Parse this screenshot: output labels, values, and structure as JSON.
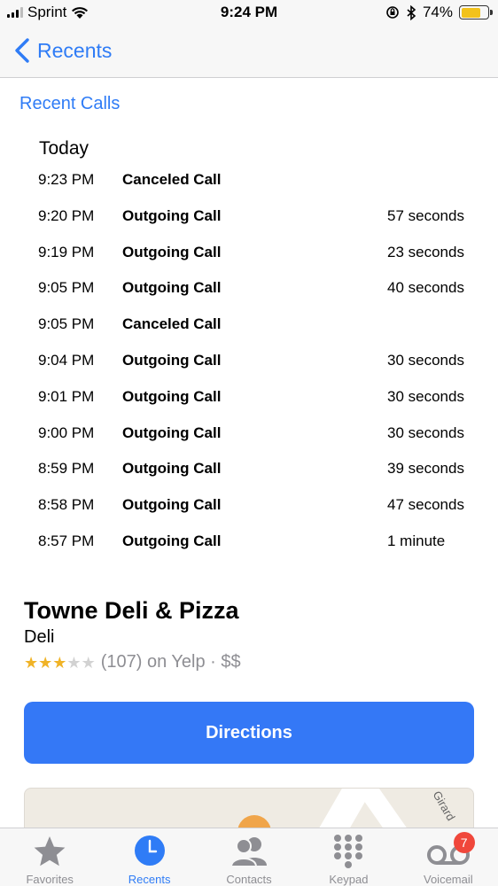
{
  "status_bar": {
    "carrier": "Sprint",
    "time": "9:24 PM",
    "battery": "74%",
    "battery_level": 0.74
  },
  "nav": {
    "back_label": "Recents"
  },
  "recent_calls": {
    "title": "Recent Calls",
    "day": "Today",
    "rows": [
      {
        "time": "9:23 PM",
        "type": "Canceled Call",
        "duration": ""
      },
      {
        "time": "9:20 PM",
        "type": "Outgoing Call",
        "duration": "57 seconds"
      },
      {
        "time": "9:19 PM",
        "type": "Outgoing Call",
        "duration": "23 seconds"
      },
      {
        "time": "9:05 PM",
        "type": "Outgoing Call",
        "duration": "40 seconds"
      },
      {
        "time": "9:05 PM",
        "type": "Canceled Call",
        "duration": ""
      },
      {
        "time": "9:04 PM",
        "type": "Outgoing Call",
        "duration": "30 seconds"
      },
      {
        "time": "9:01 PM",
        "type": "Outgoing Call",
        "duration": "30 seconds"
      },
      {
        "time": "9:00 PM",
        "type": "Outgoing Call",
        "duration": "30 seconds"
      },
      {
        "time": "8:59 PM",
        "type": "Outgoing Call",
        "duration": "39 seconds"
      },
      {
        "time": "8:58 PM",
        "type": "Outgoing Call",
        "duration": "47 seconds"
      },
      {
        "time": "8:57 PM",
        "type": "Outgoing Call",
        "duration": "1 minute"
      }
    ]
  },
  "business": {
    "name": "Towne Deli & Pizza",
    "category": "Deli",
    "rating": 3,
    "rating_max": 5,
    "rating_text": "(107) on Yelp · $$",
    "directions_label": "Directions",
    "map_street": "Girard"
  },
  "tabs": [
    {
      "label": "Favorites",
      "icon": "star-icon"
    },
    {
      "label": "Recents",
      "icon": "clock-icon",
      "active": true
    },
    {
      "label": "Contacts",
      "icon": "contacts-icon"
    },
    {
      "label": "Keypad",
      "icon": "keypad-icon"
    },
    {
      "label": "Voicemail",
      "icon": "voicemail-icon",
      "badge": "7"
    }
  ],
  "colors": {
    "accent": "#2f7cf6",
    "button": "#3478f6",
    "star": "#f0b327",
    "badge": "#f0473b"
  }
}
